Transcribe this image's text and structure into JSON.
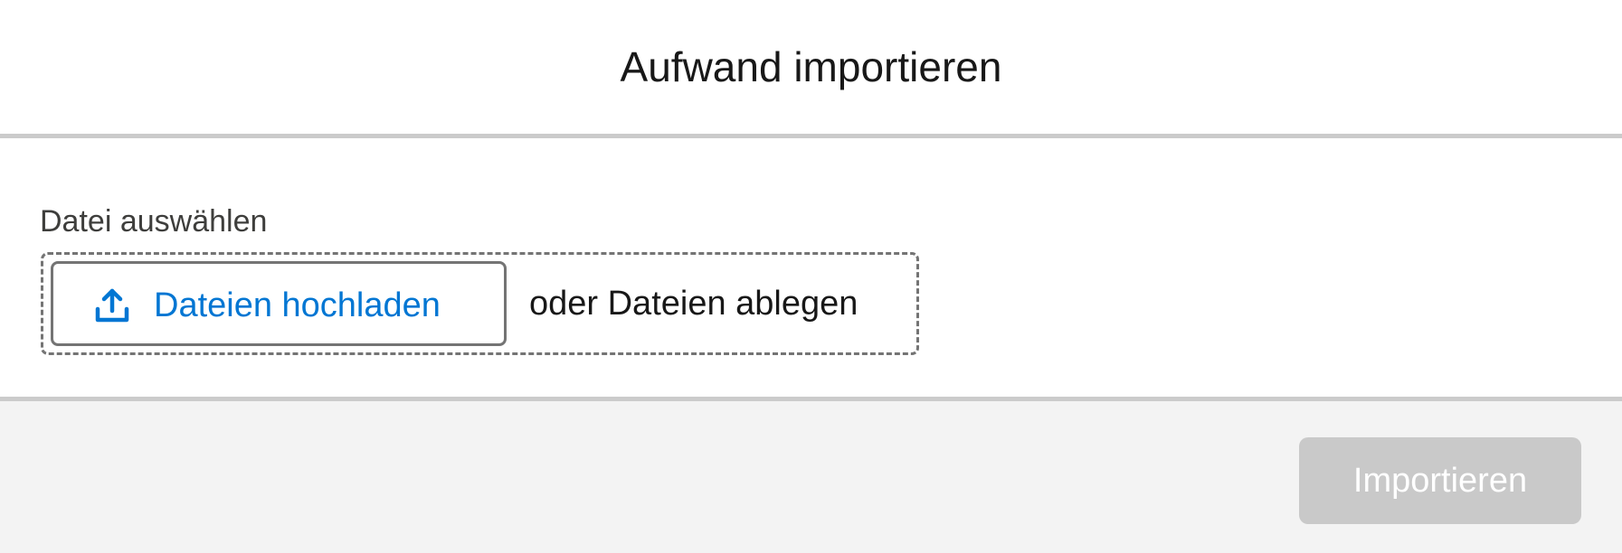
{
  "modal": {
    "title": "Aufwand importieren"
  },
  "file_field": {
    "label": "Datei auswählen",
    "upload_button_label": "Dateien hochladen",
    "upload_icon": "upload-icon",
    "drop_hint": "oder Dateien ablegen"
  },
  "footer": {
    "import_button_label": "Importieren",
    "import_button_state": "disabled"
  },
  "colors": {
    "accent": "#0176d3",
    "disabled_button": "#c9c9c9",
    "footer_background": "#f3f3f3",
    "divider": "#cbcbcb"
  }
}
